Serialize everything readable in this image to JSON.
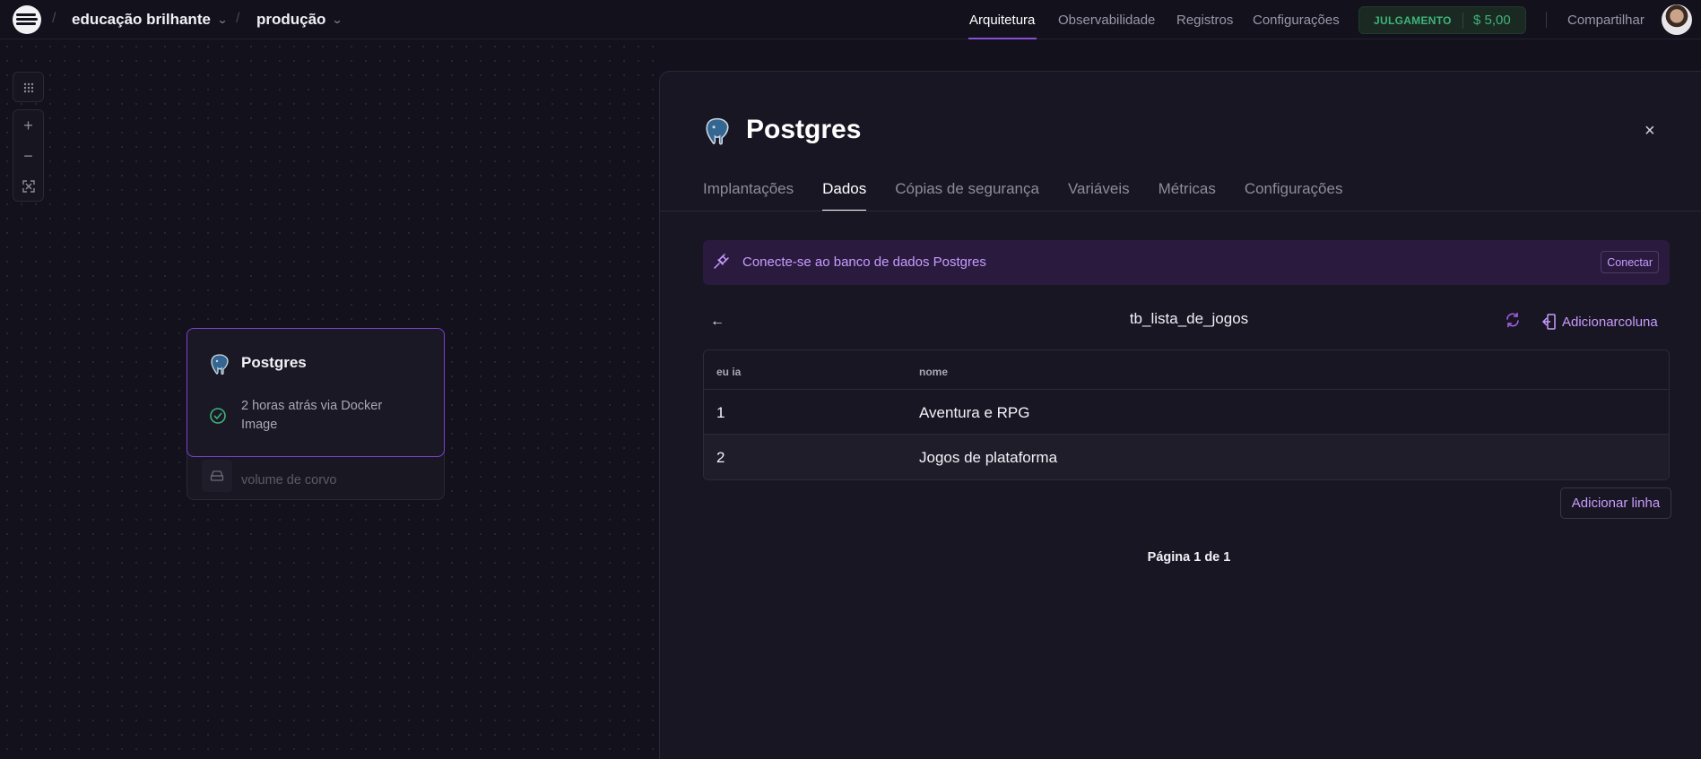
{
  "header": {
    "project": "educação brilhante",
    "environment": "produção",
    "separator": "/",
    "nav": [
      {
        "label": "Arquitetura",
        "active": true
      },
      {
        "label": "Observabilidade",
        "active": false
      },
      {
        "label": "Registros",
        "active": false
      },
      {
        "label": "Configurações",
        "active": false
      }
    ],
    "usage_badge": "JULGAMENTO",
    "usage_amount": "$ 5,00",
    "share_label": "Compartilhar"
  },
  "canvas": {
    "tools": {
      "grid": "⋮⋮⋮",
      "zoom_in": "+",
      "zoom_out": "−",
      "fit": "⤢"
    },
    "service": {
      "name": "Postgres",
      "status": "2 horas atrás via Docker Image",
      "volume": "volume de corvo"
    }
  },
  "panel": {
    "title": "Postgres",
    "close": "×",
    "tabs": [
      {
        "label": "Implantações",
        "active": false
      },
      {
        "label": "Dados",
        "active": true
      },
      {
        "label": "Cópias de segurança",
        "active": false
      },
      {
        "label": "Variáveis",
        "active": false
      },
      {
        "label": "Métricas",
        "active": false
      },
      {
        "label": "Configurações",
        "active": false
      }
    ],
    "banner": {
      "text": "Conecte-se ao banco de dados Postgres",
      "button": "Conectar"
    },
    "table_view": {
      "back": "←",
      "table_name": "tb_lista_de_jogos",
      "add_column": "Adicionarcoluna",
      "columns": [
        "eu ia",
        "nome"
      ],
      "rows": [
        [
          "1",
          "Aventura e RPG"
        ],
        [
          "2",
          "Jogos de plataforma"
        ]
      ],
      "add_row": "Adicionar linha",
      "pagination": "Página 1 de 1"
    }
  },
  "colors": {
    "background": "#13111c",
    "accent": "#8a4fd8",
    "link": "#c89cff",
    "success": "#3fb37a"
  }
}
